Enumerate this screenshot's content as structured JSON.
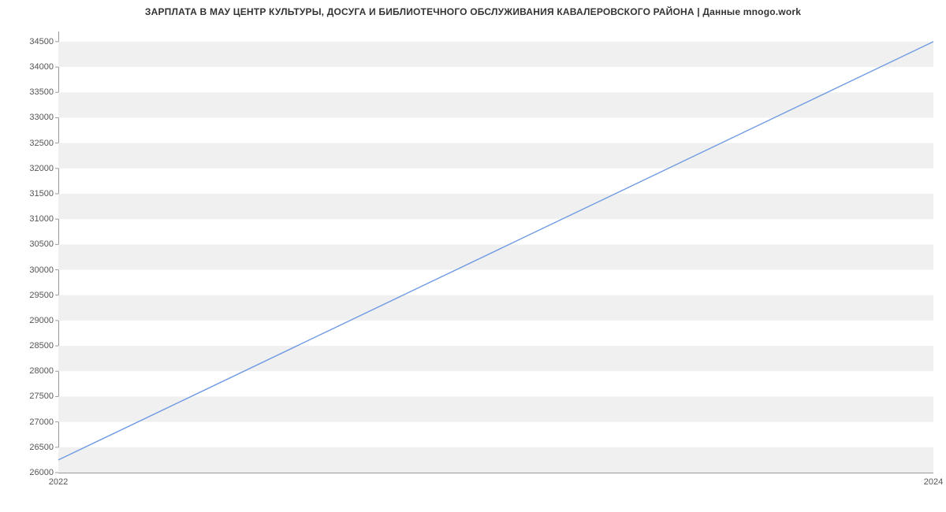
{
  "chart_data": {
    "type": "line",
    "title": "ЗАРПЛАТА В МАУ ЦЕНТР КУЛЬТУРЫ, ДОСУГА И БИБЛИОТЕЧНОГО ОБСЛУЖИВАНИЯ КАВАЛЕРОВСКОГО РАЙОНА | Данные mnogo.work",
    "x": [
      2022,
      2024
    ],
    "values": [
      26250,
      34500
    ],
    "x_ticks": [
      2022,
      2024
    ],
    "y_ticks": [
      26000,
      26500,
      27000,
      27500,
      28000,
      28500,
      29000,
      29500,
      30000,
      30500,
      31000,
      31500,
      32000,
      32500,
      33000,
      33500,
      34000,
      34500
    ],
    "xlim": [
      2022,
      2024
    ],
    "ylim": [
      26000,
      34700
    ],
    "xlabel": "",
    "ylabel": "",
    "line_color": "#6f9ae3",
    "grid_color": "#f0f0f0"
  }
}
